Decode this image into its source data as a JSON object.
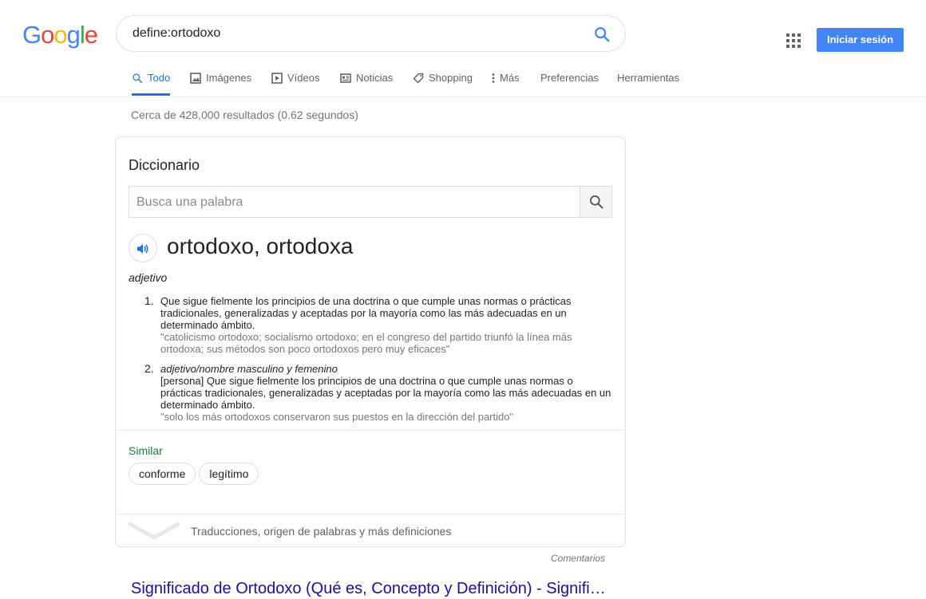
{
  "logo": {
    "letters": [
      "G",
      "o",
      "o",
      "g",
      "l",
      "e"
    ],
    "colors": [
      "#4285f4",
      "#ea4335",
      "#fbbc05",
      "#4285f4",
      "#34a853",
      "#ea4335"
    ]
  },
  "search": {
    "query": "define:ortodoxo",
    "icon": "search-icon"
  },
  "header": {
    "apps_icon": "apps-grid-icon",
    "signin_label": "Iniciar sesión"
  },
  "tabs": [
    {
      "label": "Todo",
      "icon": "search-icon",
      "active": true
    },
    {
      "label": "Imágenes",
      "icon": "image-icon"
    },
    {
      "label": "Vídeos",
      "icon": "video-icon"
    },
    {
      "label": "Noticias",
      "icon": "news-icon"
    },
    {
      "label": "Shopping",
      "icon": "tag-icon"
    },
    {
      "label": "Más",
      "icon": "more-vert-icon"
    },
    {
      "label": "Preferencias"
    },
    {
      "label": "Herramientas"
    }
  ],
  "stats": "Cerca de 428,000 resultados (0.62 segundos)",
  "dictionary": {
    "title": "Diccionario",
    "search_placeholder": "Busca una palabra",
    "headword": "ortodoxo, ortodoxa",
    "part_of_speech": "adjetivo",
    "definitions": [
      {
        "number": "1.",
        "grammar": "",
        "text": "Que sigue fielmente los principios de una doctrina o que cumple unas normas o prácticas tradicionales, generalizadas y aceptadas por la mayoría como las más adecuadas en un determinado ámbito.",
        "example": "\"catolicismo ortodoxo; socialismo ortodoxo; en el congreso del partido triunfó la línea más ortodoxa; sus métodos son poco ortodoxos pero muy eficaces\""
      },
      {
        "number": "2.",
        "grammar": "adjetivo/nombre masculino y femenino",
        "text": "[persona] Que sigue fielmente los principios de una doctrina o que cumple unas normas o prácticas tradicionales, generalizadas y aceptadas por la mayoría como las más adecuadas en un determinado ámbito.",
        "example": "\"solo los más ortodoxos conservaron sus puestos en la dirección del partido\""
      }
    ],
    "similar_label": "Similar",
    "similar": [
      "conforme",
      "legítimo"
    ],
    "more_text": "Traducciones, origen de palabras y más definiciones"
  },
  "feedback": "Comentarios",
  "first_result": {
    "title": "Significado de Ortodoxo (Qué es, Concepto y Definición) - Signifi…"
  }
}
